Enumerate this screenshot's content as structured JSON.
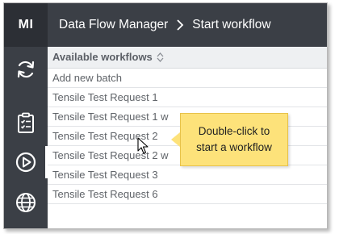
{
  "app": {
    "logo": "MI",
    "breadcrumb": {
      "root": "Data Flow Manager",
      "current": "Start workflow"
    }
  },
  "sidebar": {
    "icons": [
      {
        "name": "refresh-icon",
        "active": false
      },
      {
        "name": "clipboard-checklist-icon",
        "active": false
      },
      {
        "name": "play-circle-icon",
        "active": true
      },
      {
        "name": "globe-icon",
        "active": false
      }
    ]
  },
  "table": {
    "column_header": "Available workflows",
    "rows": [
      "Add new batch",
      "Tensile Test Request 1",
      "Tensile Test Request 1 w",
      "Tensile Test Request 2",
      "Tensile Test Request 2 w",
      "Tensile Test Request 3",
      "Tensile Test Request 6"
    ]
  },
  "tooltip": {
    "line1": "Double-click to",
    "line2": "start a workflow"
  },
  "colors": {
    "sidebar": "#3b3f46",
    "logo_bg": "#2c2f35",
    "tooltip_bg": "#fde27a"
  }
}
